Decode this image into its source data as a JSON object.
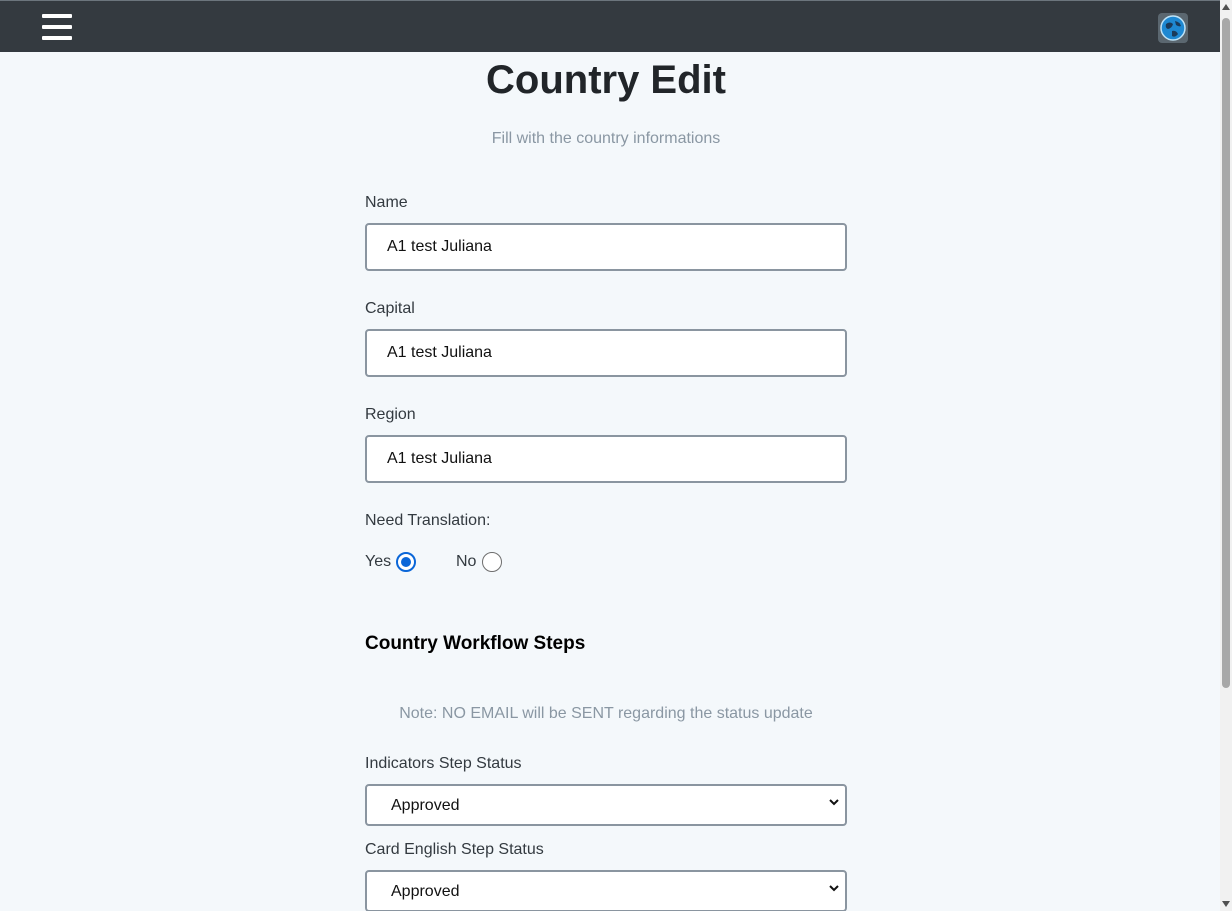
{
  "header": {
    "menu_icon": "hamburger-menu-icon",
    "logo_icon": "globe-logo-icon"
  },
  "page": {
    "title": "Country Edit",
    "subtitle": "Fill with the country informations"
  },
  "form": {
    "name": {
      "label": "Name",
      "value": "A1 test Juliana"
    },
    "capital": {
      "label": "Capital",
      "value": "A1 test Juliana"
    },
    "region": {
      "label": "Region",
      "value": "A1 test Juliana"
    },
    "translation": {
      "label": "Need Translation:",
      "options": [
        {
          "label": "Yes",
          "checked": true
        },
        {
          "label": "No",
          "checked": false
        }
      ]
    }
  },
  "workflow": {
    "title": "Country Workflow Steps",
    "note": "Note: NO EMAIL will be SENT regarding the status update",
    "steps": [
      {
        "label": "Indicators Step Status",
        "value": "Approved"
      },
      {
        "label": "Card English Step Status",
        "value": "Approved"
      }
    ]
  },
  "colors": {
    "topbar": "#343a40",
    "background": "#f4f8fb",
    "accent": "#0a66d8"
  }
}
